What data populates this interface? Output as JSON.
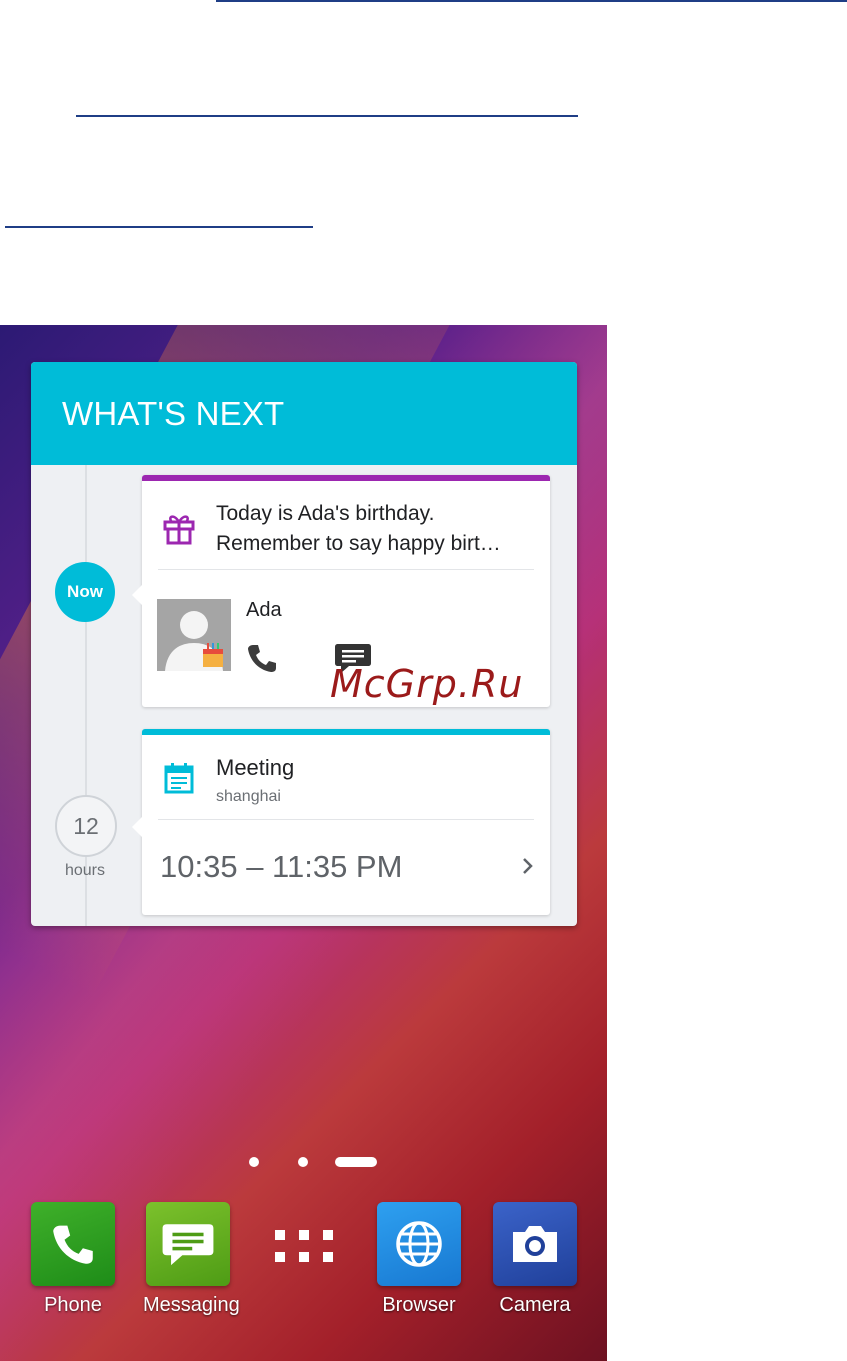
{
  "widget": {
    "title": "WHAT'S NEXT",
    "timeline": {
      "now_label": "Now",
      "count": "12",
      "unit": "hours"
    },
    "birthday_card": {
      "line1": "Today is Ada's birthday.",
      "line2": "Remember to say happy birt…",
      "contact_name": "Ada",
      "accent_color": "#9c27b0"
    },
    "meeting_card": {
      "title": "Meeting",
      "location": "shanghai",
      "time_range": "10:35 – 11:35 PM",
      "accent_color": "#00bcd8"
    }
  },
  "watermark": "McGrp.Ru",
  "page_indicator": {
    "pages": 3,
    "current": 3
  },
  "dock": {
    "apps": [
      {
        "label": "Phone",
        "icon": "phone-handset-icon"
      },
      {
        "label": "Messaging",
        "icon": "chat-bubble-icon"
      },
      {
        "label": "",
        "icon": "app-drawer-grid-icon"
      },
      {
        "label": "Browser",
        "icon": "globe-icon"
      },
      {
        "label": "Camera",
        "icon": "camera-icon"
      }
    ]
  },
  "colors": {
    "header": "#00bcd8",
    "rule": "#1f3e86"
  }
}
